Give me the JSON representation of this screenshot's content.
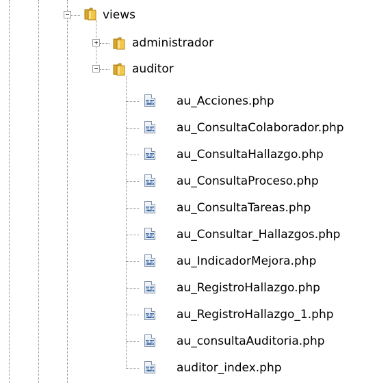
{
  "tree": {
    "views": {
      "label": "views"
    },
    "administrador": {
      "label": "administrador"
    },
    "auditor": {
      "label": "auditor"
    },
    "files": [
      "au_Acciones.php",
      "au_ConsultaColaborador.php",
      "au_ConsultaHallazgo.php",
      "au_ConsultaProceso.php",
      "au_ConsultaTareas.php",
      "au_Consultar_Hallazgos.php",
      "au_IndicadorMejora.php",
      "au_RegistroHallazgo.php",
      "au_RegistroHallazgo_1.php",
      "au_consultaAuditoria.php",
      "auditor_index.php"
    ],
    "file_icon_text": "php",
    "folder_color": "#e8b52e"
  }
}
